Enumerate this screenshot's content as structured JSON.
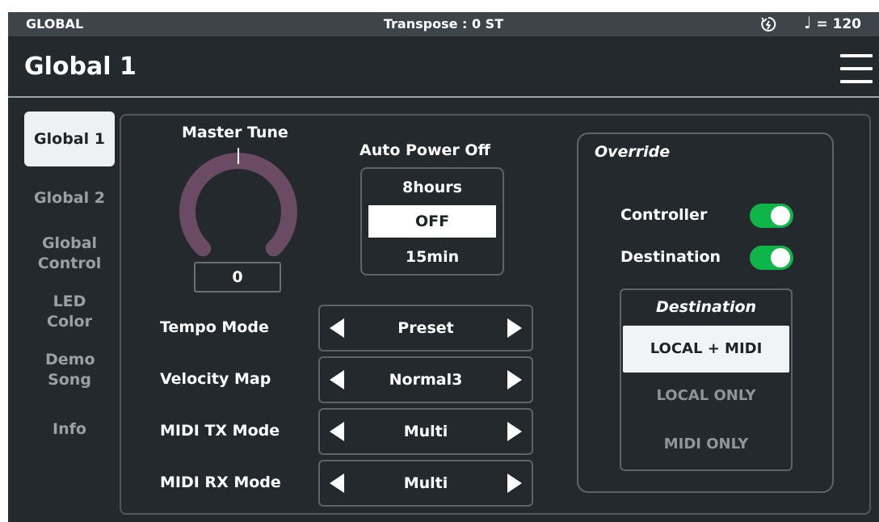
{
  "status_bar": {
    "mode": "GLOBAL",
    "transpose": "Transpose : 0 ST",
    "power_icon": "power-clock-icon",
    "tempo_note": "♩",
    "tempo_value": "= 120"
  },
  "header": {
    "title": "Global 1",
    "menu_icon": "hamburger-menu-icon"
  },
  "sidebar": {
    "items": [
      {
        "label": "Global 1",
        "active": true
      },
      {
        "label": "Global 2",
        "active": false
      },
      {
        "label": "Global Control",
        "active": false
      },
      {
        "label": "LED Color",
        "active": false
      },
      {
        "label": "Demo Song",
        "active": false
      },
      {
        "label": "Info",
        "active": false
      }
    ]
  },
  "master_tune": {
    "label": "Master Tune",
    "value": "0",
    "level": 0.5,
    "colors": {
      "track": "#6b4a63",
      "indicator": "#ffffff"
    }
  },
  "auto_power_off": {
    "label": "Auto Power Off",
    "options": [
      "8hours",
      "OFF",
      "15min"
    ],
    "selected": "OFF"
  },
  "parameters": [
    {
      "label": "Tempo Mode",
      "value": "Preset"
    },
    {
      "label": "Velocity Map",
      "value": "Normal3"
    },
    {
      "label": "MIDI TX Mode",
      "value": "Multi"
    },
    {
      "label": "MIDI RX Mode",
      "value": "Multi"
    }
  ],
  "override": {
    "title": "Override",
    "toggles": [
      {
        "label": "Controller",
        "on": true
      },
      {
        "label": "Destination",
        "on": true
      }
    ],
    "destination": {
      "title": "Destination",
      "options": [
        "LOCAL + MIDI",
        "LOCAL ONLY",
        "MIDI ONLY"
      ],
      "selected": "LOCAL + MIDI"
    }
  },
  "colors": {
    "background": "#23292d",
    "status_bar": "#3d454b",
    "toggle_on": "#10b54a",
    "panel_border": "#5d656b",
    "inactive_text": "#9aa0a4"
  }
}
